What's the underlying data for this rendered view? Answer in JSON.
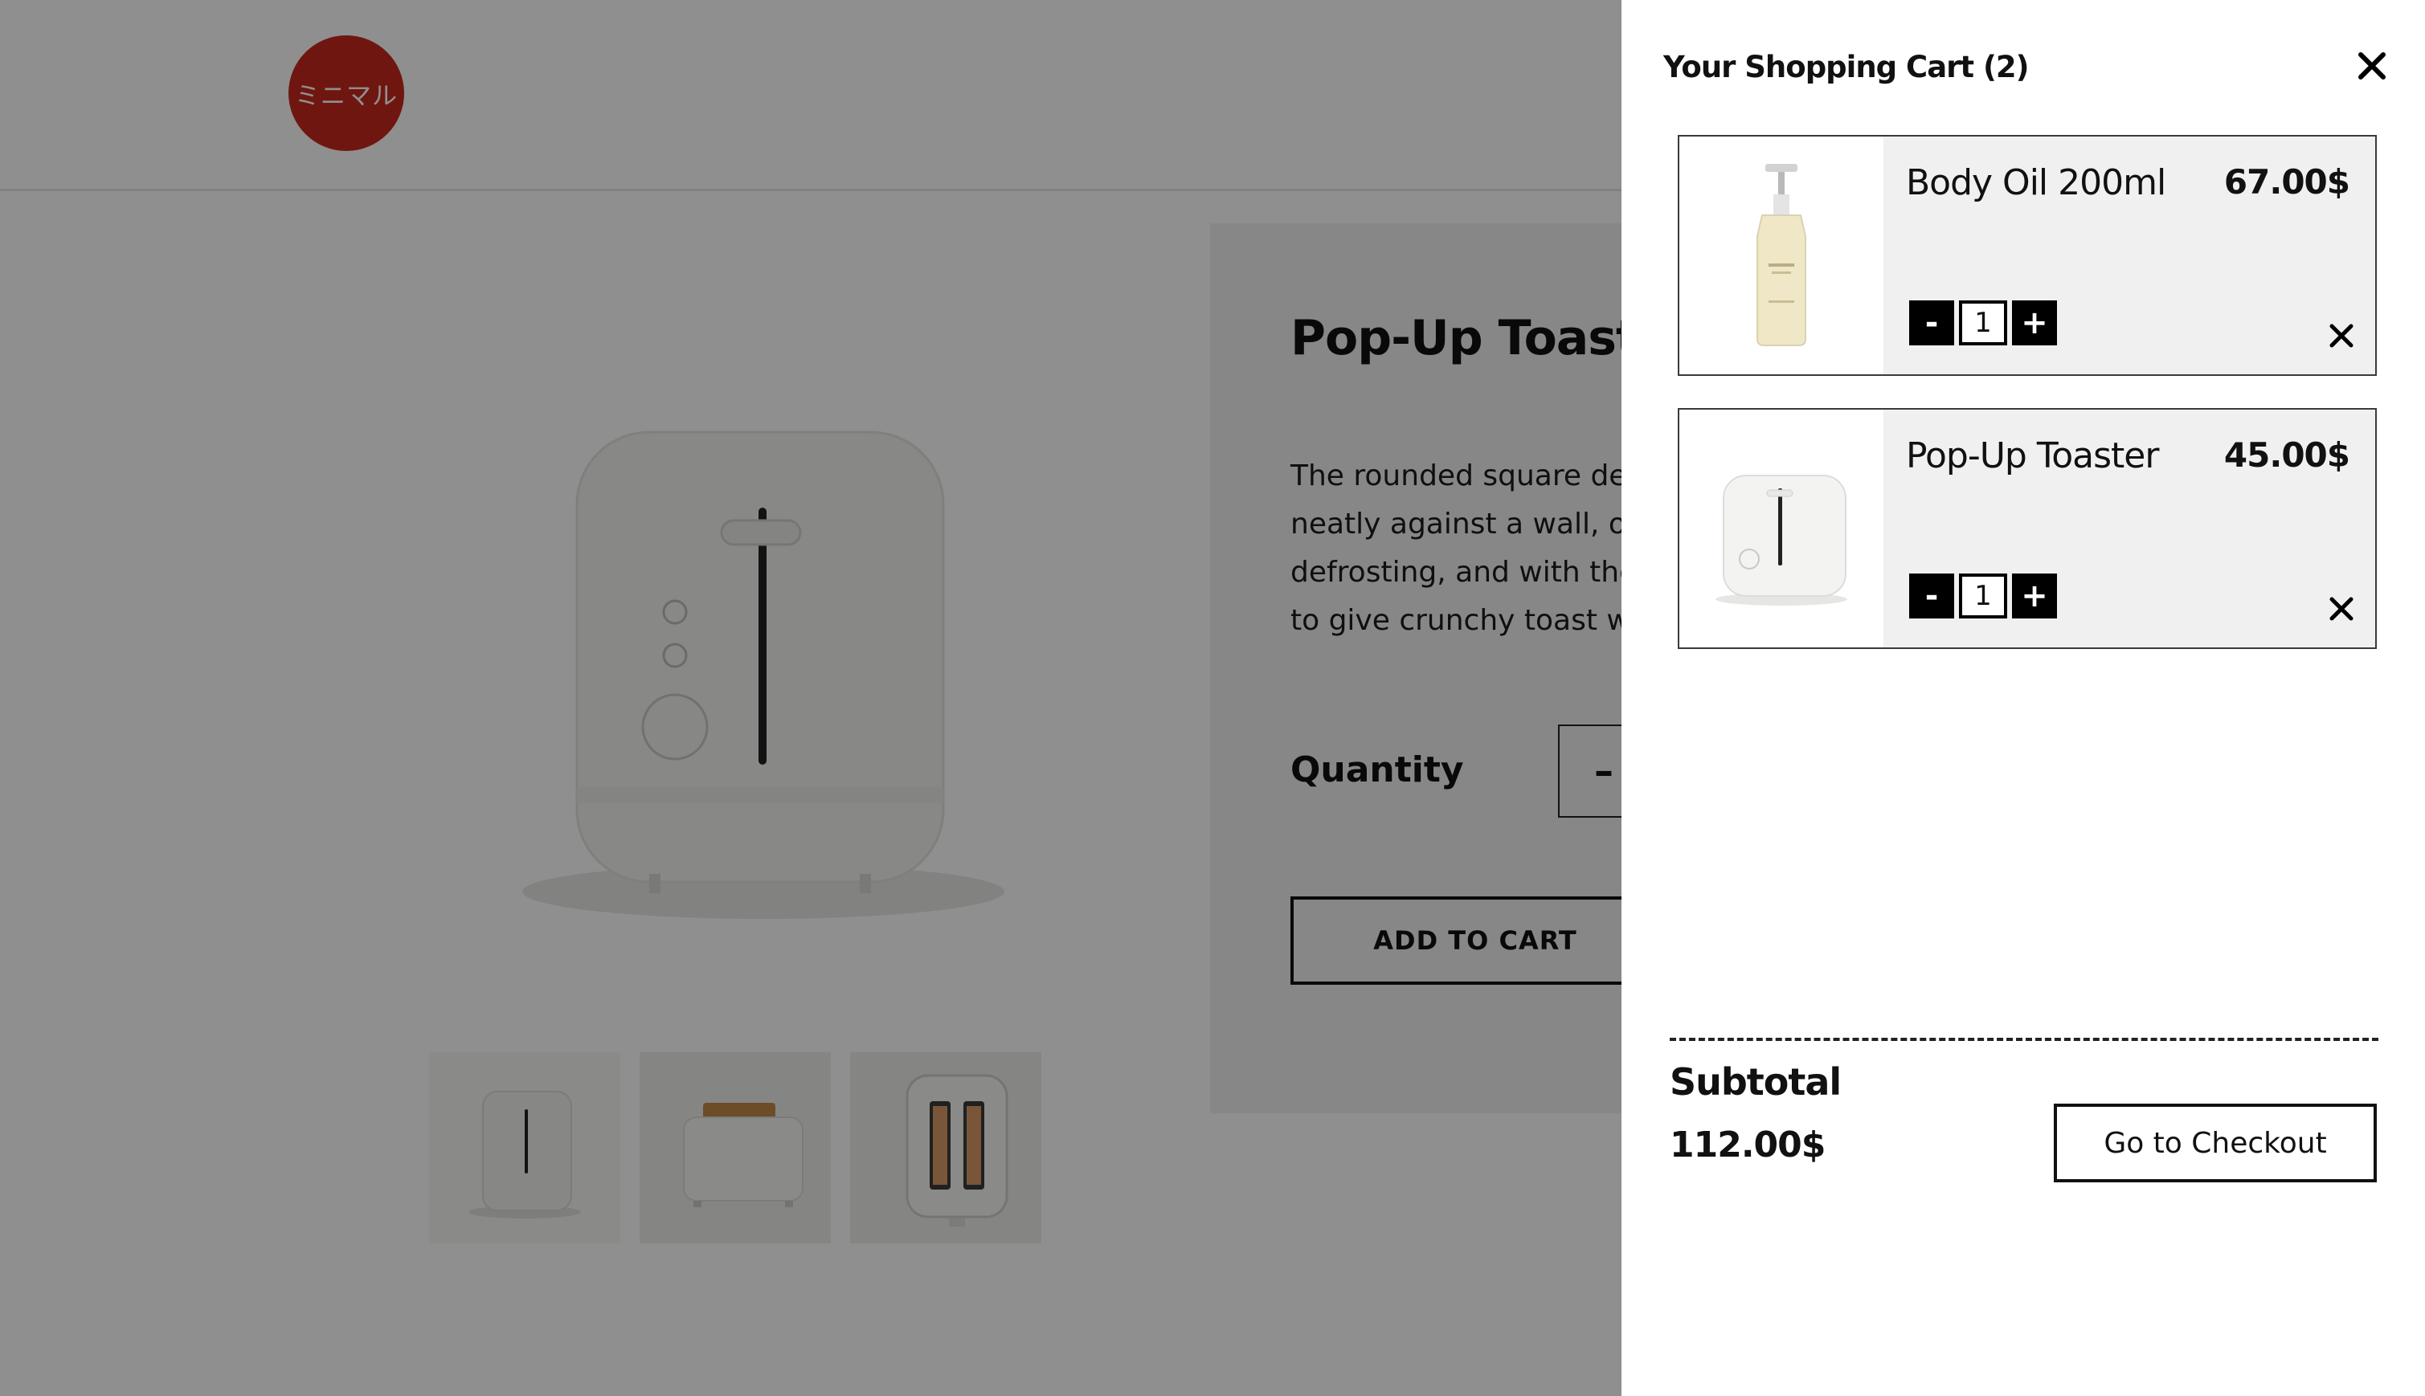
{
  "header": {
    "logo_text": "ミニマル"
  },
  "product": {
    "title": "Pop-Up Toaster",
    "description_lines": [
      "The rounded square design fits",
      "neatly against a wall, or in a",
      "defrosting, and with the pop-up",
      "to give crunchy toast with"
    ],
    "quantity_label": "Quantity",
    "quantity_minus": "–",
    "add_to_cart_label": "ADD TO CART"
  },
  "cart": {
    "title": "Your Shopping Cart (2)",
    "close_glyph": "✕",
    "items": [
      {
        "name": "Body Oil 200ml",
        "price": "67.00$",
        "quantity": "1",
        "minus": "-",
        "plus": "+",
        "icon": "body-oil-bottle"
      },
      {
        "name": "Pop-Up Toaster",
        "price": "45.00$",
        "quantity": "1",
        "minus": "-",
        "plus": "+",
        "icon": "toaster"
      }
    ],
    "subtotal_label": "Subtotal",
    "subtotal_value": "112.00$",
    "checkout_label": "Go to Checkout"
  },
  "colors": {
    "logo": "#c8281e",
    "overlay": "rgba(0,0,0,0.44)",
    "item_bg": "#f0f0f0"
  }
}
